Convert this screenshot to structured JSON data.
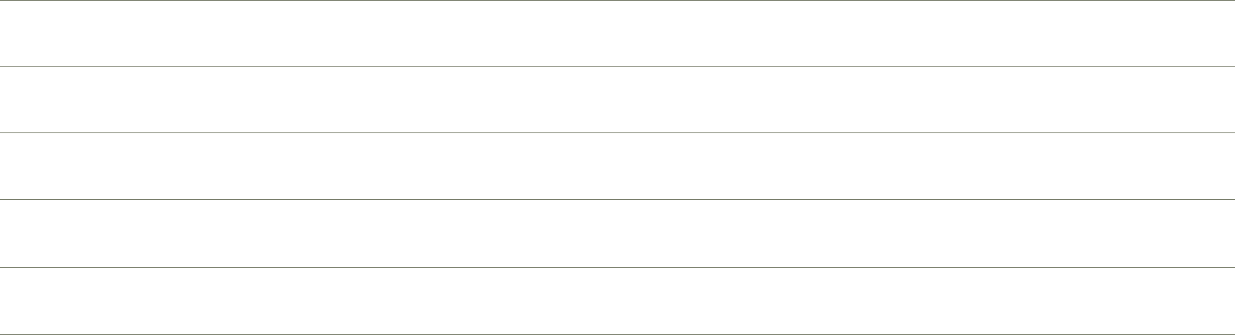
{
  "document": {
    "rule_color": "#5f654f",
    "background_color": "#ffffff",
    "lines": [
      {
        "text": ""
      },
      {
        "text": ""
      },
      {
        "text": ""
      },
      {
        "text": ""
      },
      {
        "text": ""
      },
      {
        "text": ""
      }
    ]
  }
}
